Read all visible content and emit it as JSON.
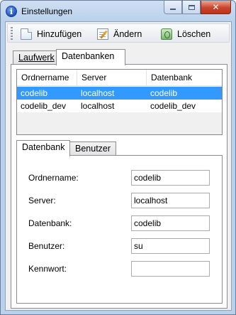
{
  "window": {
    "title": "Einstellungen"
  },
  "toolbar": {
    "add_label": "Hinzufügen",
    "edit_label": "Ändern",
    "delete_label": "Löschen"
  },
  "outer_tabs": {
    "tab1": "Laufwerk",
    "tab2": "Datenbanken",
    "active": "Datenbanken"
  },
  "list": {
    "columns": [
      "Ordnername",
      "Server",
      "Datenbank"
    ],
    "rows": [
      {
        "ordnername": "codelib",
        "server": "localhost",
        "datenbank": "codelib",
        "selected": true
      },
      {
        "ordnername": "codelib_dev",
        "server": "localhost",
        "datenbank": "codelib_dev",
        "selected": false
      }
    ]
  },
  "inner_tabs": {
    "tab1": "Datenbank",
    "tab2": "Benutzer",
    "active": "Datenbank"
  },
  "form": {
    "ordnername_label": "Ordnername:",
    "ordnername_value": "codelib",
    "server_label": "Server:",
    "server_value": "localhost",
    "datenbank_label": "Datenbank:",
    "datenbank_value": "codelib",
    "benutzer_label": "Benutzer:",
    "benutzer_value": "su",
    "kennwort_label": "Kennwort:",
    "kennwort_value": ""
  },
  "icons": {
    "app": "info-icon",
    "add": "new-document-icon",
    "edit": "edit-document-icon",
    "delete": "recycle-icon"
  },
  "colors": {
    "selection": "#3399ff",
    "frame": "#b9d1ec",
    "close_button": "#c8452c"
  }
}
